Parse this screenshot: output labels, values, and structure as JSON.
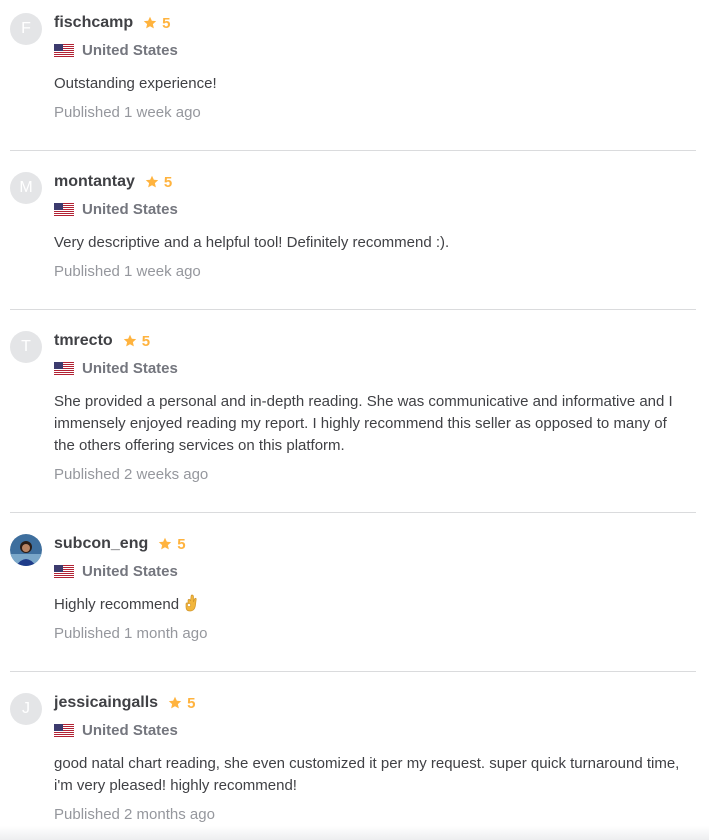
{
  "reviews": [
    {
      "initial": "F",
      "username": "fischcamp",
      "rating": "5",
      "country": "United States",
      "text": "Outstanding experience!",
      "published": "Published 1 week ago"
    },
    {
      "initial": "M",
      "username": "montantay",
      "rating": "5",
      "country": "United States",
      "text": "Very descriptive and a helpful tool! Definitely recommend :).",
      "published": "Published 1 week ago"
    },
    {
      "initial": "T",
      "username": "tmrecto",
      "rating": "5",
      "country": "United States",
      "text": "She provided a personal and in-depth reading. She was communicative and informative and I immensely enjoyed reading my report. I highly recommend this seller as opposed to many of the others offering services on this platform.",
      "published": "Published 2 weeks ago"
    },
    {
      "initial": "",
      "username": "subcon_eng",
      "rating": "5",
      "country": "United States",
      "text": "Highly recommend",
      "emoji": "ok-hand-icon",
      "published": "Published 1 month ago"
    },
    {
      "initial": "J",
      "username": "jessicaingalls",
      "rating": "5",
      "country": "United States",
      "text": "good natal chart reading, she even customized it per my request. super quick turnaround time, i'm very pleased! highly recommend!",
      "published": "Published 2 months ago"
    }
  ],
  "colors": {
    "star": "#ffb33e",
    "username": "#404145",
    "country": "#74767e",
    "published": "#95979d",
    "divider": "#dadbdd",
    "avatar_bg": "#e4e5e7"
  }
}
